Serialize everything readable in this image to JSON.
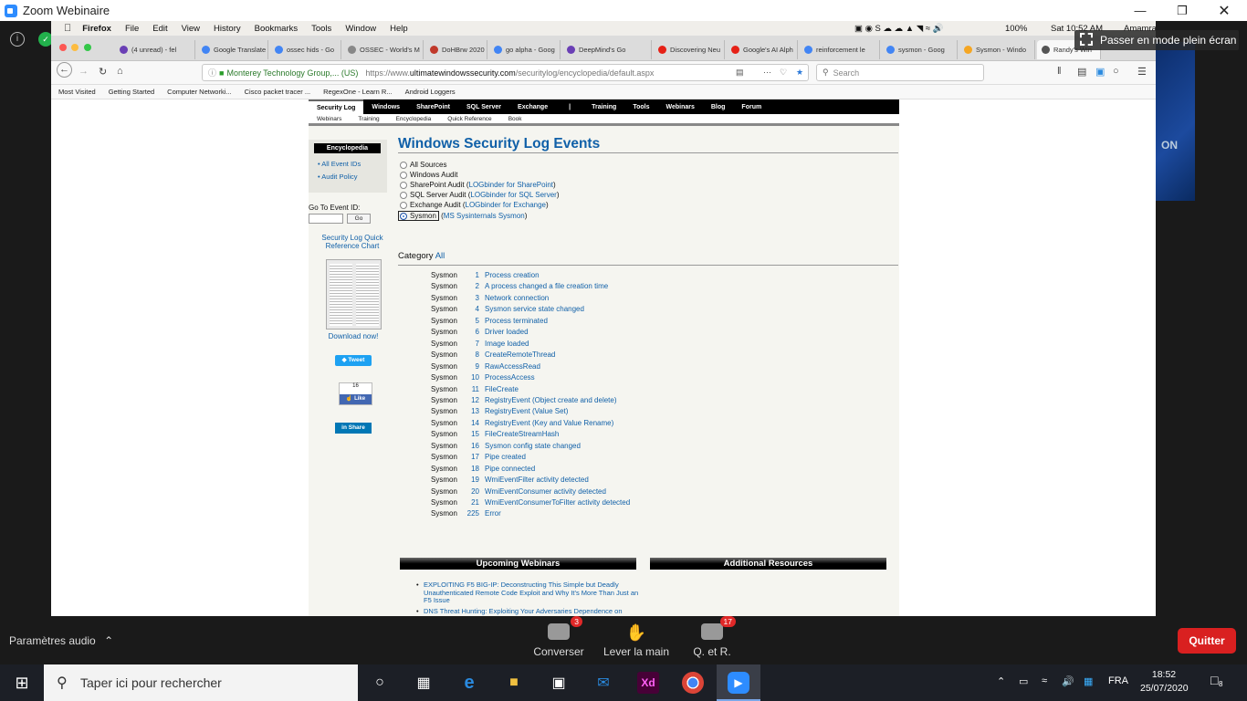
{
  "zoom": {
    "title": "Zoom Webinaire",
    "fullscreen_label": "Passer en mode plein écran",
    "audio_label": "Paramètres audio",
    "chat_label": "Converser",
    "chat_badge": "3",
    "raise_hand_label": "Lever la main",
    "qa_label": "Q. et R.",
    "qa_badge": "17",
    "quit_label": "Quitter"
  },
  "mac_menu": {
    "app": "Firefox",
    "items": [
      "File",
      "Edit",
      "View",
      "History",
      "Bookmarks",
      "Tools",
      "Window",
      "Help"
    ],
    "battery": "100%",
    "time": "Sat 10:52 AM",
    "user": "Amamra"
  },
  "browser": {
    "tabs": [
      {
        "label": "(4 unread) - fel",
        "color": "#6a3fb5"
      },
      {
        "label": "Google Translate",
        "color": "#4285f4"
      },
      {
        "label": "ossec hids - Go",
        "color": "#4285f4"
      },
      {
        "label": "OSSEC - World's M",
        "color": "#888"
      },
      {
        "label": "DoHBrw 2020 |",
        "color": "#c0392b"
      },
      {
        "label": "go alpha - Goog",
        "color": "#4285f4"
      },
      {
        "label": "DeepMind's Go",
        "color": "#6a3fb5"
      },
      {
        "label": "Discovering Neu",
        "color": "#e62117"
      },
      {
        "label": "Google's AI Alph",
        "color": "#e62117"
      },
      {
        "label": "reinforcement le",
        "color": "#4285f4"
      },
      {
        "label": "sysmon - Goog",
        "color": "#4285f4"
      },
      {
        "label": "Sysmon - Windo",
        "color": "#f5a623"
      },
      {
        "label": "Randy's Win",
        "color": "#555"
      }
    ],
    "cert": "Monterey Technology Group,... (US)",
    "url_prefix": "https://www.",
    "url_domain": "ultimatewindowssecurity.com",
    "url_path": "/securitylog/encyclopedia/default.aspx",
    "search_placeholder": "Search",
    "bookmarks": [
      "Most Visited",
      "Getting Started",
      "Computer Networki...",
      "Cisco packet tracer ...",
      "RegexOne - Learn R...",
      "Android Loggers"
    ]
  },
  "site": {
    "topnav": [
      "Security Log",
      "Windows",
      "SharePoint",
      "SQL Server",
      "Exchange",
      "|",
      "Training",
      "Tools",
      "Webinars",
      "Blog",
      "Forum"
    ],
    "subnav": [
      "Webinars",
      "Training",
      "Encyclopedia",
      "Quick Reference",
      "Book"
    ],
    "sidebar_title": "Encyclopedia",
    "sidebar_links": [
      "All Event IDs",
      "Audit Policy"
    ],
    "goto_label": "Go To Event ID:",
    "go_button": "Go",
    "chart_label": "Security Log Quick Reference Chart",
    "download": "Download now!",
    "tweet": "Tweet",
    "fb_count": "16",
    "fb_like": "Like",
    "share": "Share",
    "heading": "Windows Security Log Events",
    "sources": [
      {
        "label": "All Sources",
        "link": ""
      },
      {
        "label": "Windows Audit",
        "link": ""
      },
      {
        "label": "SharePoint Audit",
        "link": "LOGbinder for SharePoint"
      },
      {
        "label": "SQL Server Audit",
        "link": "LOGbinder for SQL Server"
      },
      {
        "label": "Exchange Audit",
        "link": "LOGbinder for Exchange"
      },
      {
        "label": "Sysmon",
        "link": "MS Sysinternals Sysmon"
      }
    ],
    "category_label": "Category",
    "category_value": "All",
    "events": [
      {
        "source": "Sysmon",
        "id": "1",
        "desc": "Process creation"
      },
      {
        "source": "Sysmon",
        "id": "2",
        "desc": "A process changed a file creation time"
      },
      {
        "source": "Sysmon",
        "id": "3",
        "desc": "Network connection"
      },
      {
        "source": "Sysmon",
        "id": "4",
        "desc": "Sysmon service state changed"
      },
      {
        "source": "Sysmon",
        "id": "5",
        "desc": "Process terminated"
      },
      {
        "source": "Sysmon",
        "id": "6",
        "desc": "Driver loaded"
      },
      {
        "source": "Sysmon",
        "id": "7",
        "desc": "Image loaded"
      },
      {
        "source": "Sysmon",
        "id": "8",
        "desc": "CreateRemoteThread"
      },
      {
        "source": "Sysmon",
        "id": "9",
        "desc": "RawAccessRead"
      },
      {
        "source": "Sysmon",
        "id": "10",
        "desc": "ProcessAccess"
      },
      {
        "source": "Sysmon",
        "id": "11",
        "desc": "FileCreate"
      },
      {
        "source": "Sysmon",
        "id": "12",
        "desc": "RegistryEvent (Object create and delete)"
      },
      {
        "source": "Sysmon",
        "id": "13",
        "desc": "RegistryEvent (Value Set)"
      },
      {
        "source": "Sysmon",
        "id": "14",
        "desc": "RegistryEvent (Key and Value Rename)"
      },
      {
        "source": "Sysmon",
        "id": "15",
        "desc": "FileCreateStreamHash"
      },
      {
        "source": "Sysmon",
        "id": "16",
        "desc": "Sysmon config state changed"
      },
      {
        "source": "Sysmon",
        "id": "17",
        "desc": "Pipe created"
      },
      {
        "source": "Sysmon",
        "id": "18",
        "desc": "Pipe connected"
      },
      {
        "source": "Sysmon",
        "id": "19",
        "desc": "WmiEventFilter activity detected"
      },
      {
        "source": "Sysmon",
        "id": "20",
        "desc": "WmiEventConsumer activity detected"
      },
      {
        "source": "Sysmon",
        "id": "21",
        "desc": "WmiEventConsumerToFilter activity detected"
      },
      {
        "source": "Sysmon",
        "id": "225",
        "desc": "Error"
      }
    ],
    "webinars_title": "Upcoming Webinars",
    "resources_title": "Additional Resources",
    "webinars": [
      "EXPLOITING F5 BIG-IP: Deconstructing This Simple but Deadly Unauthenticated Remote Code Exploit and Why It's More Than Just an F5 Issue",
      "DNS Threat Hunting: Exploiting Your Adversaries Dependence on Domain Names"
    ]
  },
  "taskbar": {
    "search_placeholder": "Taper ici pour rechercher",
    "language": "FRA",
    "time": "18:52",
    "date": "25/07/2020",
    "notif_count": "8"
  }
}
